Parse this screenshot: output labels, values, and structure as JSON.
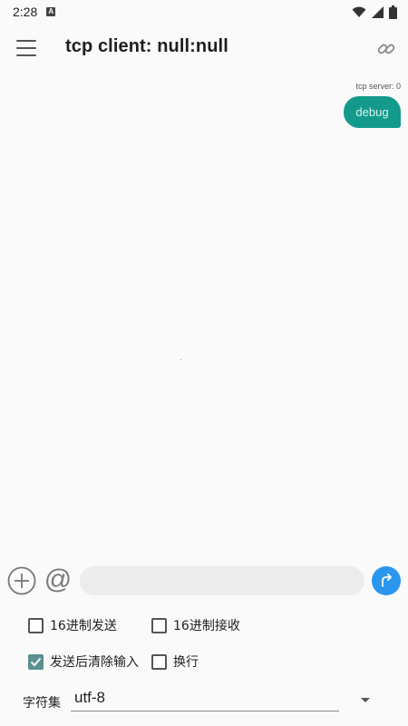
{
  "status_bar": {
    "time": "2:28",
    "notification_icon": "a-icon",
    "icons": [
      "wifi-icon",
      "signal-icon",
      "battery-icon"
    ]
  },
  "app_bar": {
    "menu_icon": "hamburger-icon",
    "title": "tcp client: null:null",
    "link_icon": "link-icon"
  },
  "messages": [
    {
      "meta": "tcp server: 0",
      "text": "debug"
    }
  ],
  "input_row": {
    "add_icon": "plus-circle-icon",
    "at_label": "@",
    "message_value": "",
    "send_icon": "send-arrow-icon"
  },
  "options": {
    "hex_send": {
      "label": "16进制发送",
      "checked": false
    },
    "hex_receive": {
      "label": "16进制接收",
      "checked": false
    },
    "clear_after_send": {
      "label": "发送后清除输入",
      "checked": true
    },
    "newline": {
      "label": "换行",
      "checked": false
    }
  },
  "charset": {
    "label": "字符集",
    "selected": "utf-8"
  },
  "colors": {
    "accent": "#149a8c",
    "send": "#2b96ed",
    "checkbox_checked": "#5b8f91"
  }
}
